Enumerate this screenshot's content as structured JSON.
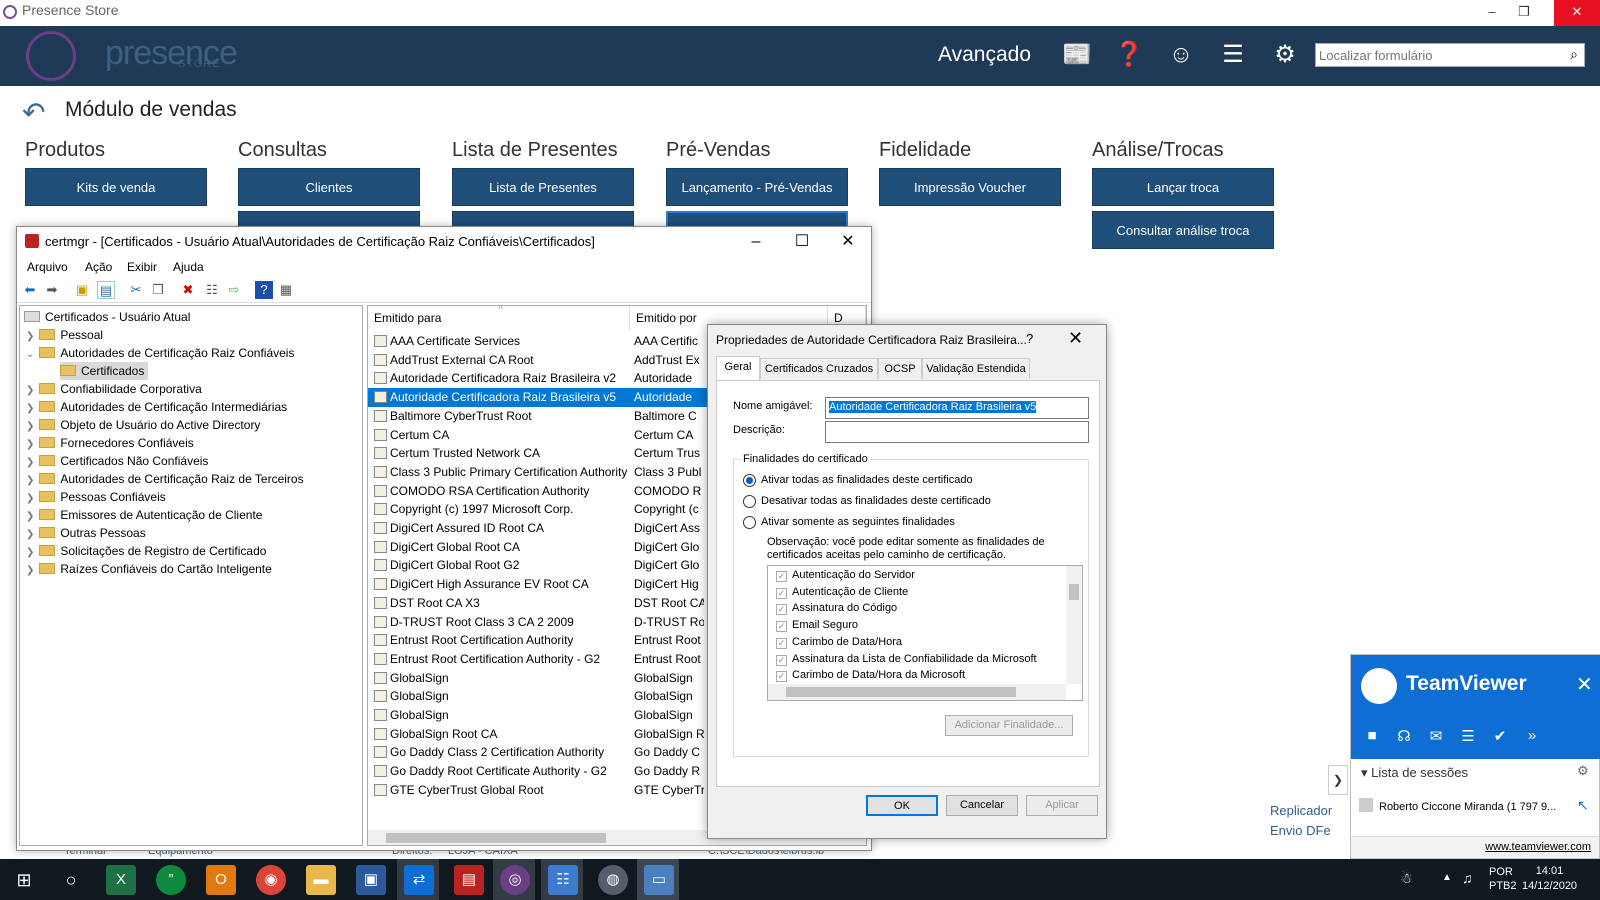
{
  "app": {
    "title": "Presence Store"
  },
  "header": {
    "brand": "presence",
    "brand_sub": "STORE",
    "advanced_label": "Avançado",
    "search_placeholder": "Localizar formulário"
  },
  "module": {
    "title": "Módulo de vendas"
  },
  "categories": [
    {
      "title": "Produtos",
      "buttons": [
        "Kits de venda"
      ]
    },
    {
      "title": "Consultas",
      "buttons": [
        "Clientes"
      ]
    },
    {
      "title": "Lista de Presentes",
      "buttons": [
        "Lista de Presentes"
      ]
    },
    {
      "title": "Pré-Vendas",
      "buttons": [
        "Lançamento - Pré-Vendas"
      ]
    },
    {
      "title": "Fidelidade",
      "buttons": [
        "Impressão Voucher"
      ]
    },
    {
      "title": "Análise/Trocas",
      "buttons": [
        "Lançar troca",
        "Consultar análise troca"
      ]
    }
  ],
  "certmgr": {
    "title": "certmgr - [Certificados - Usuário Atual\\Autoridades de Certificação Raiz Confiáveis\\Certificados]",
    "menu": [
      "Arquivo",
      "Ação",
      "Exibir",
      "Ajuda"
    ],
    "tree": [
      "Certificados - Usuário Atual",
      "Pessoal",
      "Autoridades de Certificação Raiz Confiáveis",
      "Certificados",
      "Confiabilidade Corporativa",
      "Autoridades de Certificação Intermediárias",
      "Objeto de Usuário do Active Directory",
      "Fornecedores Confiáveis",
      "Certificados Não Confiáveis",
      "Autoridades de Certificação Raiz de Terceiros",
      "Pessoas Confiáveis",
      "Emissores de Autenticação de Cliente",
      "Outras Pessoas",
      "Solicitações de Registro de Certificado",
      "Raízes Confiáveis do Cartão Inteligente"
    ],
    "columns": [
      "Emitido para",
      "Emitido por",
      "D"
    ],
    "rows": [
      [
        "AAA Certificate Services",
        "AAA Certific"
      ],
      [
        "AddTrust External CA Root",
        "AddTrust Ex"
      ],
      [
        "Autoridade Certificadora Raiz Brasileira v2",
        "Autoridade"
      ],
      [
        "Autoridade Certificadora Raiz Brasileira v5",
        "Autoridade"
      ],
      [
        "Baltimore CyberTrust Root",
        "Baltimore C"
      ],
      [
        "Certum CA",
        "Certum CA"
      ],
      [
        "Certum Trusted Network CA",
        "Certum Trus"
      ],
      [
        "Class 3 Public Primary Certification Authority",
        "Class 3 Publ"
      ],
      [
        "COMODO RSA Certification Authority",
        "COMODO R"
      ],
      [
        "Copyright (c) 1997 Microsoft Corp.",
        "Copyright (c"
      ],
      [
        "DigiCert Assured ID Root CA",
        "DigiCert Ass"
      ],
      [
        "DigiCert Global Root CA",
        "DigiCert Glo"
      ],
      [
        "DigiCert Global Root G2",
        "DigiCert Glo"
      ],
      [
        "DigiCert High Assurance EV Root CA",
        "DigiCert Hig"
      ],
      [
        "DST Root CA X3",
        "DST Root CA"
      ],
      [
        "D-TRUST Root Class 3 CA 2 2009",
        "D-TRUST Ro"
      ],
      [
        "Entrust Root Certification Authority",
        "Entrust Root"
      ],
      [
        "Entrust Root Certification Authority - G2",
        "Entrust Root"
      ],
      [
        "GlobalSign",
        "GlobalSign"
      ],
      [
        "GlobalSign",
        "GlobalSign"
      ],
      [
        "GlobalSign",
        "GlobalSign"
      ],
      [
        "GlobalSign Root CA",
        "GlobalSign R"
      ],
      [
        "Go Daddy Class 2 Certification Authority",
        "Go Daddy C"
      ],
      [
        "Go Daddy Root Certificate Authority - G2",
        "Go Daddy R"
      ],
      [
        "GTE CyberTrust Global Root",
        "GTE CyberTr"
      ]
    ]
  },
  "dialog": {
    "title": "Propriedades de Autoridade Certificadora Raiz Brasileira...",
    "help": "?",
    "tabs": [
      "Geral",
      "Certificados Cruzados",
      "OCSP",
      "Validação Estendida"
    ],
    "friendly_label": "Nome amigável:",
    "friendly_value": "Autoridade Certificadora Raiz Brasileira v5",
    "desc_label": "Descrição:",
    "desc_value": "",
    "group_title": "Finalidades do certificado",
    "radios": [
      "Ativar todas as finalidades deste certificado",
      "Desativar todas as finalidades deste certificado",
      "Ativar somente as seguintes finalidades"
    ],
    "note": "Observação: você pode editar somente as finalidades de certificados aceitas pelo caminho de certificação.",
    "purposes": [
      "Autenticação do Servidor",
      "Autenticação de Cliente",
      "Assinatura do Código",
      "Email Seguro",
      "Carimbo de Data/Hora",
      "Assinatura da Lista de Confiabilidade da Microsoft",
      "Carimbo de Data/Hora da Microsoft"
    ],
    "add_button": "Adicionar Finalidade...",
    "ok": "OK",
    "cancel": "Cancelar",
    "apply": "Aplicar"
  },
  "teamviewer": {
    "name": "TeamViewer",
    "sessions": "Lista de sessões",
    "user": "Roberto Ciccone Miranda (1 797 9...",
    "link": "www.teamviewer.com"
  },
  "side": {
    "replicador": "Replicador",
    "envio": "Envio DFe"
  },
  "bottom_bg": {
    "a": "Terminal",
    "b": "Equipamento",
    "c": "Direitos:",
    "d": "LOJA - CAIXA",
    "e": "C:\\SCE\\Dados\\elbrus.ib"
  },
  "taskbar": {
    "lang1": "POR",
    "lang2": "PTB2",
    "time": "14:01",
    "date": "14/12/2020"
  }
}
